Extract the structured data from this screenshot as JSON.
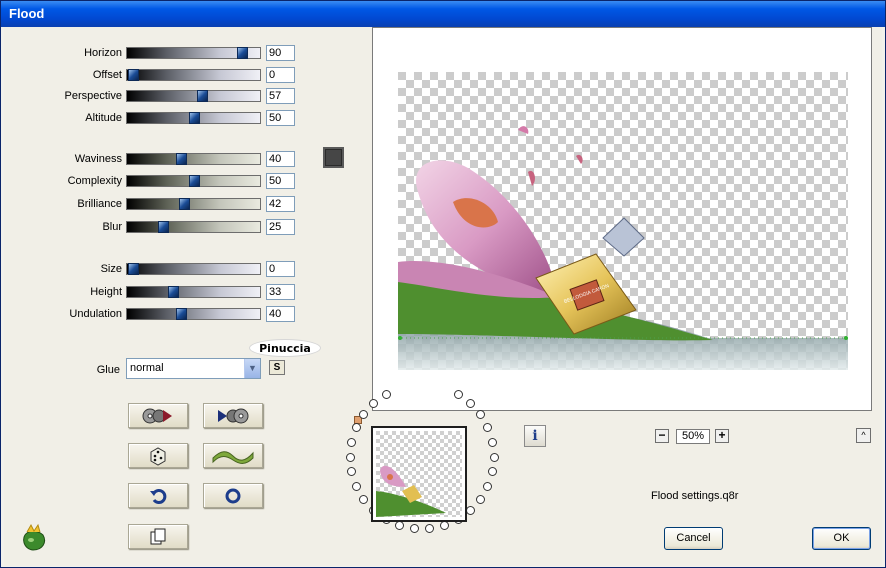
{
  "window": {
    "title": "Flood"
  },
  "sliders": [
    {
      "label": "Horizon",
      "value": "90",
      "fraction": 0.9,
      "group": 1
    },
    {
      "label": "Offset",
      "value": "0",
      "fraction": 0.0,
      "group": 1
    },
    {
      "label": "Perspective",
      "value": "57",
      "fraction": 0.57,
      "group": 1
    },
    {
      "label": "Altitude",
      "value": "50",
      "fraction": 0.5,
      "group": 1
    },
    {
      "label": "Waviness",
      "value": "40",
      "fraction": 0.4,
      "group": 2
    },
    {
      "label": "Complexity",
      "value": "50",
      "fraction": 0.5,
      "group": 2
    },
    {
      "label": "Brilliance",
      "value": "42",
      "fraction": 0.42,
      "group": 2
    },
    {
      "label": "Blur",
      "value": "25",
      "fraction": 0.25,
      "group": 2
    },
    {
      "label": "Size",
      "value": "0",
      "fraction": 0.0,
      "group": 3
    },
    {
      "label": "Height",
      "value": "33",
      "fraction": 0.33,
      "group": 3
    },
    {
      "label": "Undulation",
      "value": "40",
      "fraction": 0.4,
      "group": 3
    }
  ],
  "color_swatch": {
    "color": "#464646"
  },
  "signature": "Pinuccia",
  "glue": {
    "label": "Glue",
    "selected": "normal",
    "s_button": "S"
  },
  "toolbar_icons": [
    "load-preset-icon",
    "save-preset-icon",
    "random-dice-icon",
    "wave-icon",
    "undo-icon",
    "reset-icon",
    "copy-icon"
  ],
  "zoom": {
    "minus": "−",
    "value": "50%",
    "plus": "+"
  },
  "info_button": "i",
  "collapse_button": "^",
  "settings_file": "Flood settings.q8r",
  "buttons": {
    "cancel": "Cancel",
    "ok": "OK"
  },
  "preview": {
    "watermark_label": "BELLODGIA CARON"
  }
}
